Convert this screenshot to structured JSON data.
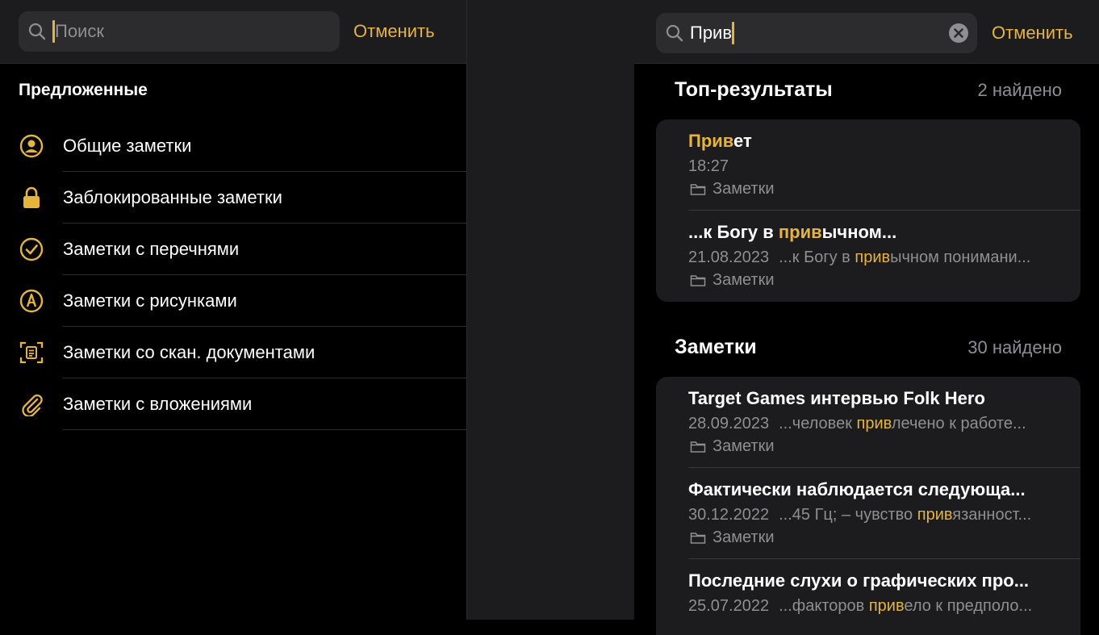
{
  "left": {
    "search": {
      "placeholder": "Поиск",
      "cancel_label": "Отменить"
    },
    "suggested_title": "Предложенные",
    "suggestions": [
      {
        "label": "Общие заметки",
        "icon": "shared-person-icon"
      },
      {
        "label": "Заблокированные заметки",
        "icon": "lock-icon"
      },
      {
        "label": "Заметки с перечнями",
        "icon": "checkmark-circle-icon"
      },
      {
        "label": "Заметки с рисунками",
        "icon": "pencil-tip-circle-icon"
      },
      {
        "label": "Заметки со скан. документами",
        "icon": "scan-document-icon"
      },
      {
        "label": "Заметки с вложениями",
        "icon": "paperclip-icon"
      }
    ]
  },
  "right": {
    "search": {
      "value": "Прив",
      "cancel_label": "Отменить"
    },
    "top": {
      "title": "Топ-результаты",
      "count": "2 найдено",
      "notes": [
        {
          "title_hl": "Прив",
          "title_rest": "ет",
          "date": "18:27",
          "snip_pre": "",
          "snip_hl": "",
          "snip_post": "",
          "folder": "Заметки"
        },
        {
          "title_pre": "...к Богу в ",
          "title_hl": "прив",
          "title_rest": "ычном...",
          "date": "21.08.2023",
          "snip_pre": "...к Богу в ",
          "snip_hl": "прив",
          "snip_post": "ычном понимани...",
          "folder": "Заметки"
        }
      ]
    },
    "notes": {
      "title": "Заметки",
      "count": "30 найдено",
      "items": [
        {
          "title": "Target Games интервью Folk Hero",
          "date": "28.09.2023",
          "snip_pre": "...человек ",
          "snip_hl": "прив",
          "snip_post": "лечено к работе...",
          "folder": "Заметки"
        },
        {
          "title": "Фактически наблюдается следующа...",
          "date": "30.12.2022",
          "snip_pre": "...45 Гц; – чувство ",
          "snip_hl": "прив",
          "snip_post": "язанност...",
          "folder": "Заметки"
        },
        {
          "title": "Последние слухи о графических про...",
          "date": "25.07.2022",
          "snip_pre": "...факторов ",
          "snip_hl": "прив",
          "snip_post": "ело к предполо...",
          "folder": ""
        }
      ]
    }
  },
  "colors": {
    "accent": "#e6b43c",
    "secondary_text": "#8e8e93",
    "card_bg": "#1c1c1e"
  }
}
